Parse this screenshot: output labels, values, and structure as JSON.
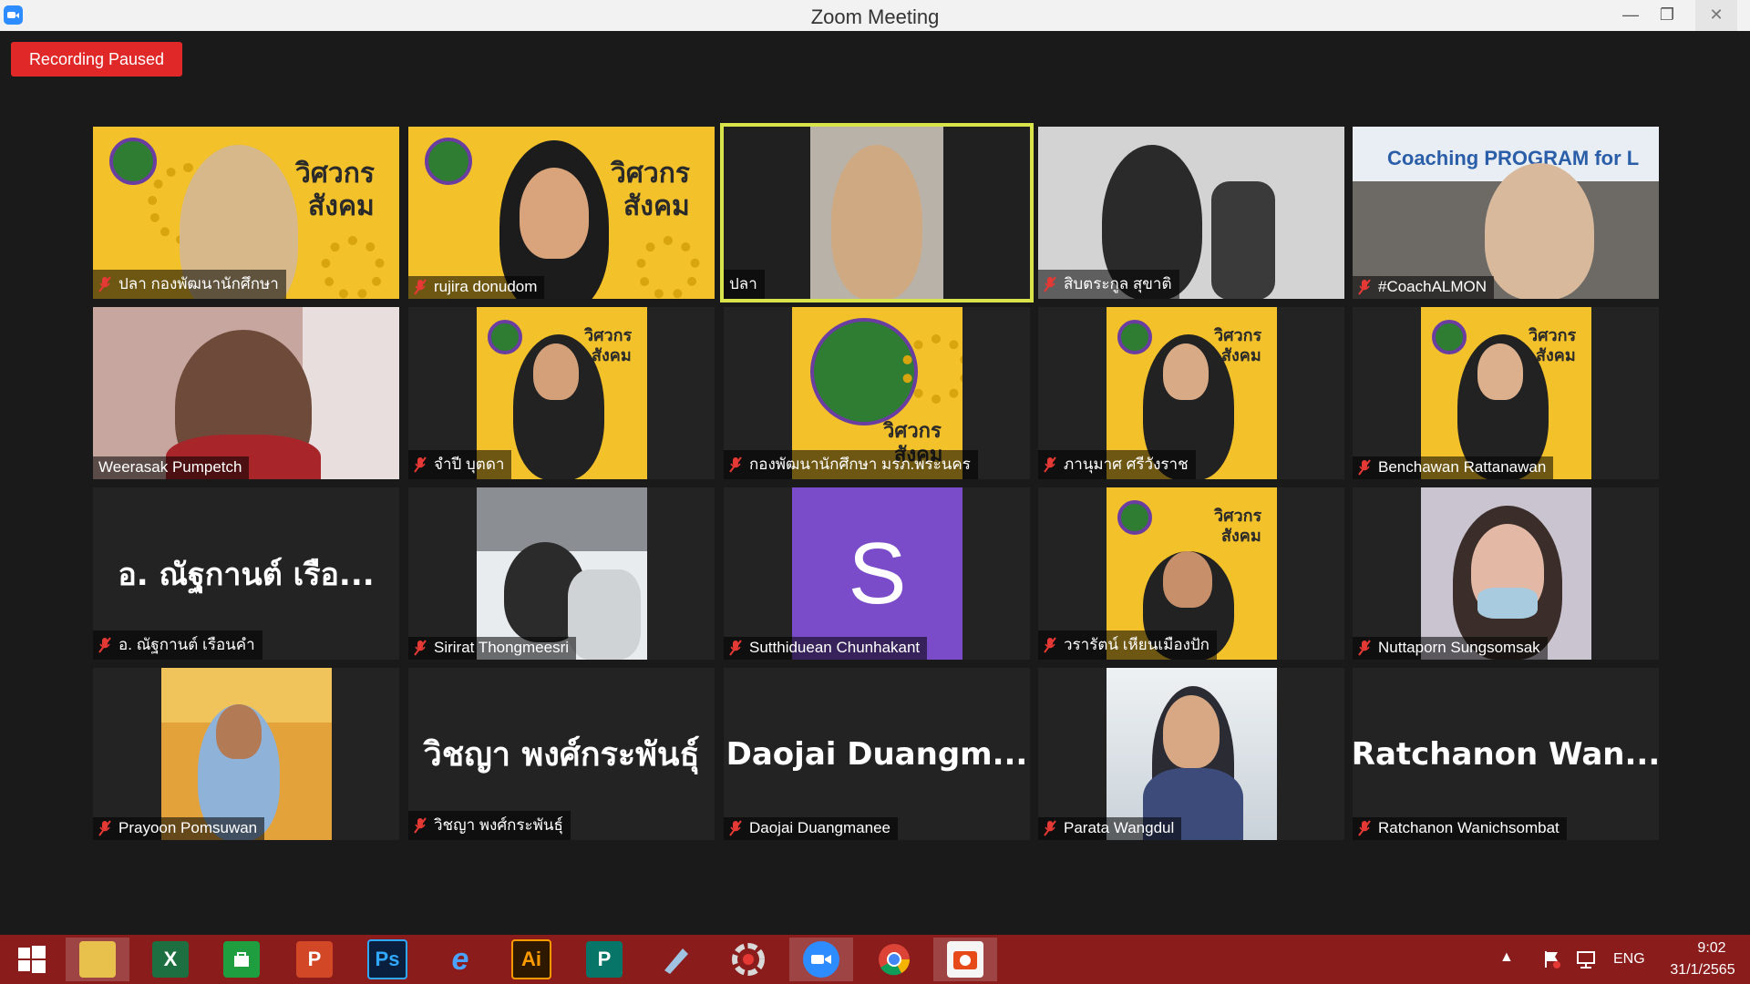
{
  "window": {
    "title": "Zoom Meeting",
    "minimize_glyph": "—",
    "maximize_glyph": "❐",
    "close_glyph": "✕"
  },
  "recording": {
    "label": "Recording Paused"
  },
  "poster": {
    "title_line1": "วิศวกร",
    "title_line2": "สังคม"
  },
  "participants": [
    {
      "name": "ปลา กองพัฒนานักศึกษา",
      "muted": true
    },
    {
      "name": "rujira donudom",
      "muted": true
    },
    {
      "name": "ปลา",
      "muted": false,
      "active_speaker": true
    },
    {
      "name": "สิบตระกูล สุขาติ",
      "muted": true
    },
    {
      "name": "#CoachALMON",
      "muted": true,
      "banner": "Coaching PROGRAM for L"
    },
    {
      "name": "Weerasak Pumpetch",
      "muted": false
    },
    {
      "name": "จำปี บุตดา",
      "muted": true
    },
    {
      "name": "กองพัฒนานักศึกษา มรภ.พระนคร",
      "muted": true
    },
    {
      "name": "ภานุมาศ ศรีวังราช",
      "muted": true
    },
    {
      "name": "Benchawan Rattanawan",
      "muted": true
    },
    {
      "name": "อ. ณัฐกานต์ เรือนคำ",
      "muted": true,
      "display_text": "อ. ณัฐกานต์  เรือ..."
    },
    {
      "name": "Sirirat Thongmeesri",
      "muted": true
    },
    {
      "name": "Sutthiduean Chunhakant",
      "muted": true,
      "avatar_letter": "S"
    },
    {
      "name": "วรารัตน์ เหียนเมืองปัก",
      "muted": true
    },
    {
      "name": "Nuttaporn Sungsomsak",
      "muted": true
    },
    {
      "name": "Prayoon Pomsuwan",
      "muted": true
    },
    {
      "name": "วิชญา พงศ์กระพันธุ์",
      "muted": true,
      "display_text": "วิชญา พงศ์กระพันธุ์"
    },
    {
      "name": "Daojai Duangmanee",
      "muted": true,
      "display_text": "Daojai  Duangm..."
    },
    {
      "name": "Parata Wangdul",
      "muted": true
    },
    {
      "name": "Ratchanon Wanichsombat",
      "muted": true,
      "display_text": "Ratchanon  Wan..."
    }
  ],
  "taskbar": {
    "apps": [
      {
        "name": "Windows Start",
        "glyph": ""
      },
      {
        "name": "File Explorer",
        "glyph": ""
      },
      {
        "name": "Excel",
        "glyph": "X"
      },
      {
        "name": "Store",
        "glyph": ""
      },
      {
        "name": "PowerPoint",
        "glyph": "P"
      },
      {
        "name": "Photoshop",
        "glyph": "Ps"
      },
      {
        "name": "Internet Explorer",
        "glyph": "e"
      },
      {
        "name": "Illustrator",
        "glyph": "Ai"
      },
      {
        "name": "Publisher",
        "glyph": "P"
      },
      {
        "name": "Pen tool",
        "glyph": ""
      },
      {
        "name": "PhotoScape",
        "glyph": ""
      },
      {
        "name": "Zoom",
        "glyph": ""
      },
      {
        "name": "Chrome",
        "glyph": ""
      },
      {
        "name": "Photo app",
        "glyph": ""
      }
    ],
    "language": "ENG",
    "time": "9:02",
    "date": "31/1/2565"
  },
  "colors": {
    "recording_red": "#e02828",
    "active_speaker_border": "#d9e34a",
    "taskbar": "#8a1c1c",
    "poster_yellow": "#f3c12a",
    "avatar_purple": "#7a4cc9"
  }
}
